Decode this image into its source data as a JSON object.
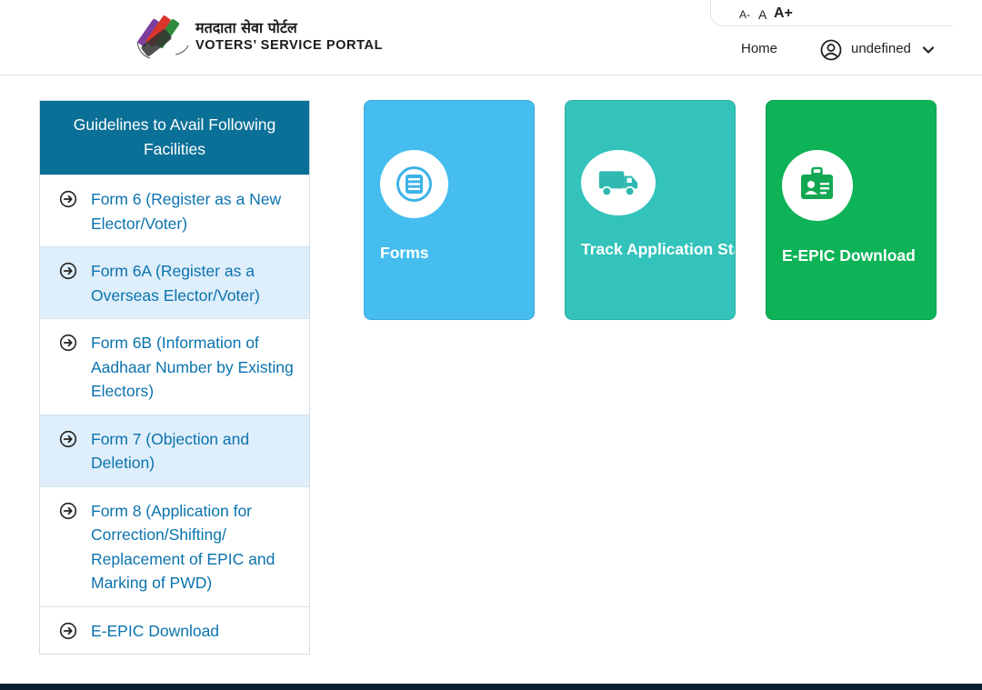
{
  "header": {
    "brand_hindi": "मतदाता सेवा पोर्टल",
    "brand_english": "VOTERS’ SERVICE PORTAL",
    "font_controls": {
      "small": "A-",
      "normal": "A",
      "large": "A+"
    },
    "nav_home": "Home",
    "user_name": "undefined"
  },
  "guidelines": {
    "title": "Guidelines to Avail Following Facilities",
    "items": [
      {
        "label": "Form 6 (Register as a New Elector/Voter)"
      },
      {
        "label": "Form 6A (Register as a Overseas Elector/Voter)"
      },
      {
        "label": "Form 6B (Information of Aadhaar Number by Existing Electors)"
      },
      {
        "label": "Form 7 (Objection and Deletion)"
      },
      {
        "label": "Form 8 (Application for Correction/Shifting/ Replacement of EPIC and Marking of PWD)"
      },
      {
        "label": "E-EPIC Download"
      }
    ]
  },
  "tiles": [
    {
      "label": "Forms",
      "icon": "document-list-icon",
      "color": "#45bdee"
    },
    {
      "label": "Track Application Sta",
      "icon": "truck-icon",
      "color": "#33c3bb"
    },
    {
      "label": "E-EPIC Download",
      "icon": "id-card-icon",
      "color": "#0db356"
    }
  ],
  "colors": {
    "guide_header_bg": "#0b7097",
    "link_blue": "#0b73ae",
    "alt_row_bg": "#deeefb",
    "footer_bar": "#0c2033"
  }
}
